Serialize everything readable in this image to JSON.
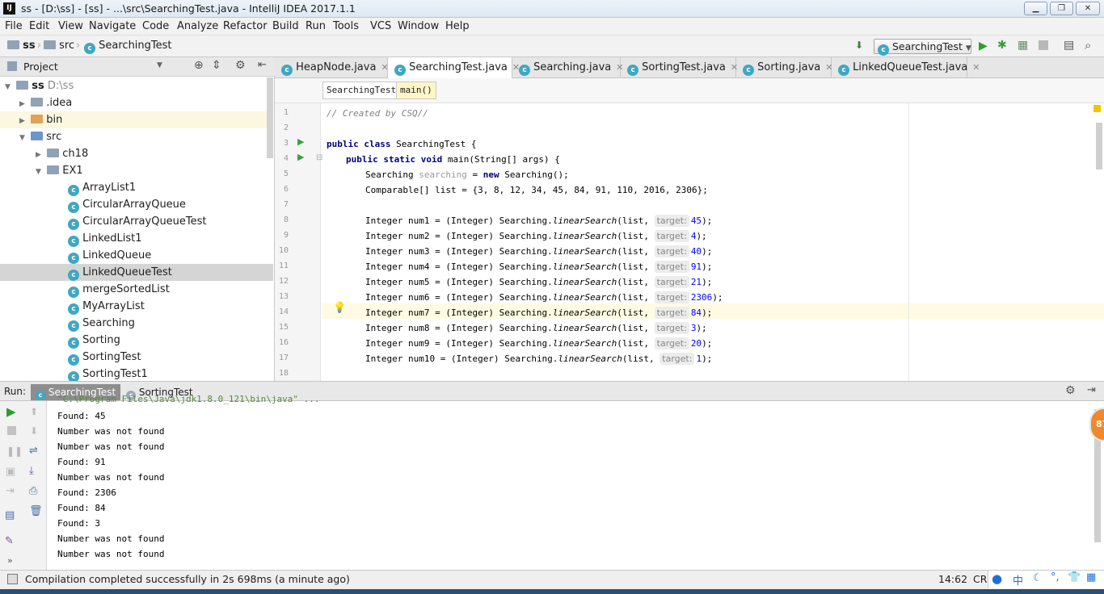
{
  "window": {
    "title": "ss - [D:\\ss] - [ss] - ...\\src\\SearchingTest.java - IntelliJ IDEA 2017.1.1"
  },
  "menu": [
    "File",
    "Edit",
    "View",
    "Navigate",
    "Code",
    "Analyze",
    "Refactor",
    "Build",
    "Run",
    "Tools",
    "VCS",
    "Window",
    "Help"
  ],
  "nav": {
    "crumbs": [
      "ss",
      "src",
      "SearchingTest"
    ],
    "run_config": "SearchingTest"
  },
  "project": {
    "header": "Project",
    "tree": [
      {
        "label": "ss",
        "path": "D:\\ss"
      },
      {
        "label": ".idea"
      },
      {
        "label": "bin"
      },
      {
        "label": "src"
      },
      {
        "label": "ch18"
      },
      {
        "label": "EX1"
      },
      {
        "label": "ArrayList1"
      },
      {
        "label": "CircularArrayQueue"
      },
      {
        "label": "CircularArrayQueueTest"
      },
      {
        "label": "LinkedList1"
      },
      {
        "label": "LinkedQueue"
      },
      {
        "label": "LinkedQueueTest"
      },
      {
        "label": "mergeSortedList"
      },
      {
        "label": "MyArrayList"
      },
      {
        "label": "Searching"
      },
      {
        "label": "Sorting"
      },
      {
        "label": "SortingTest"
      },
      {
        "label": "SortingTest1"
      }
    ]
  },
  "tabs": [
    "HeapNode.java",
    "SearchingTest.java",
    "Searching.java",
    "SortingTest.java",
    "Sorting.java",
    "LinkedQueueTest.java"
  ],
  "editor_crumbs": [
    "SearchingTest",
    "main()"
  ],
  "code": {
    "line_numbers": [
      "1",
      "2",
      "3",
      "4",
      "5",
      "6",
      "7",
      "8",
      "9",
      "10",
      "11",
      "12",
      "13",
      "14",
      "15",
      "16",
      "17",
      "18"
    ],
    "comment": "// Created by CSQ//",
    "l3a": "public class",
    "l3b": " SearchingTest {",
    "l4a": "public static void",
    "l4b": " main(String[] args) {",
    "l5a": "Searching ",
    "l5b": "searching",
    "l5c": " = ",
    "l5d": "new",
    "l5e": " Searching();",
    "l6": "Comparable[] list = {3, 8, 12, 34, 45, 84, 91, 110, 2016, 2306};",
    "hint_label": "target:",
    "search_calls": [
      {
        "var": "num1",
        "target": "45"
      },
      {
        "var": "num2",
        "target": "4"
      },
      {
        "var": "num3",
        "target": "40"
      },
      {
        "var": "num4",
        "target": "91"
      },
      {
        "var": "num5",
        "target": "21"
      },
      {
        "var": "num6",
        "target": "2306"
      },
      {
        "var": "num7",
        "target": "84"
      },
      {
        "var": "num8",
        "target": "3"
      },
      {
        "var": "num9",
        "target": "20"
      },
      {
        "var": "num10",
        "target": "1"
      }
    ],
    "call_prefix_a": "Integer ",
    "call_prefix_b": " = (Integer) Searching.",
    "call_method": "linearSearch",
    "call_arg": "(list, ",
    "call_end": ");"
  },
  "run": {
    "label": "Run:",
    "tabs": [
      "SearchingTest",
      "SortingTest"
    ],
    "cmd_line": "\"C:\\Program Files\\Java\\jdk1.8.0_121\\bin\\java\" ...",
    "output": [
      "Found: 45",
      "Number was not found",
      "Number was not found",
      "Found: 91",
      "Number was not found",
      "Found: 2306",
      "Found: 84",
      "Found: 3",
      "Number was not found",
      "Number was not found"
    ]
  },
  "status": {
    "message": "Compilation completed successfully in 2s 698ms (a minute ago)",
    "position": "14:62",
    "encoding": "CR"
  },
  "badge": "87"
}
